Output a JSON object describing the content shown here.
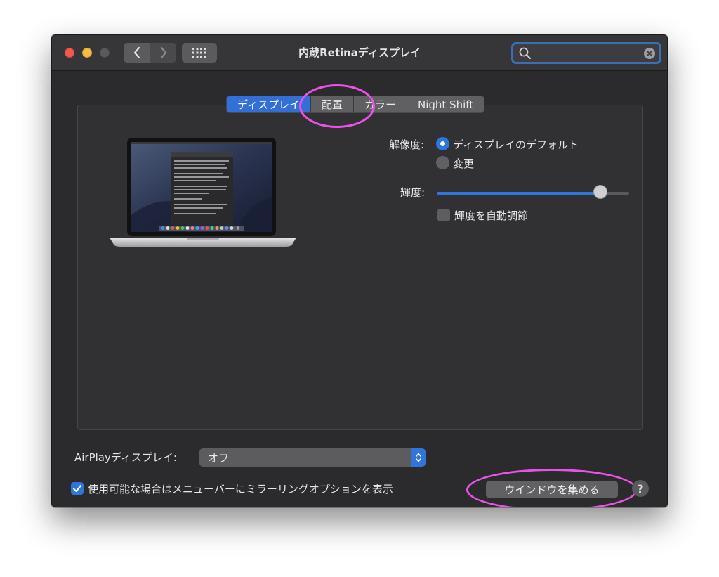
{
  "window": {
    "title": "内蔵Retinaディスプレイ"
  },
  "toolbar": {
    "back_icon": "chevron-left-icon",
    "forward_icon": "chevron-right-icon",
    "show_all_icon": "grid-icon"
  },
  "search": {
    "value": "",
    "placeholder": ""
  },
  "tabs": [
    {
      "label": "ディスプレイ",
      "active": true
    },
    {
      "label": "配置",
      "active": false
    },
    {
      "label": "カラー",
      "active": false
    },
    {
      "label": "Night Shift",
      "active": false
    }
  ],
  "display": {
    "resolution_label": "解像度:",
    "resolution_options": [
      {
        "label": "ディスプレイのデフォルト",
        "selected": true
      },
      {
        "label": "変更",
        "selected": false
      }
    ],
    "brightness_label": "輝度:",
    "brightness_value": 0.85,
    "auto_brightness_label": "輝度を自動調節",
    "auto_brightness_checked": false
  },
  "airplay": {
    "label": "AirPlayディスプレイ:",
    "value": "オフ"
  },
  "mirroring": {
    "label": "使用可能な場合はメニューバーにミラーリングオプションを表示",
    "checked": true
  },
  "footer": {
    "gather_windows_label": "ウインドウを集める",
    "help_label": "?"
  },
  "colors": {
    "accent": "#2e75dc",
    "highlight_ring": "#ec52e8",
    "window_bg": "#2b2b2d"
  }
}
